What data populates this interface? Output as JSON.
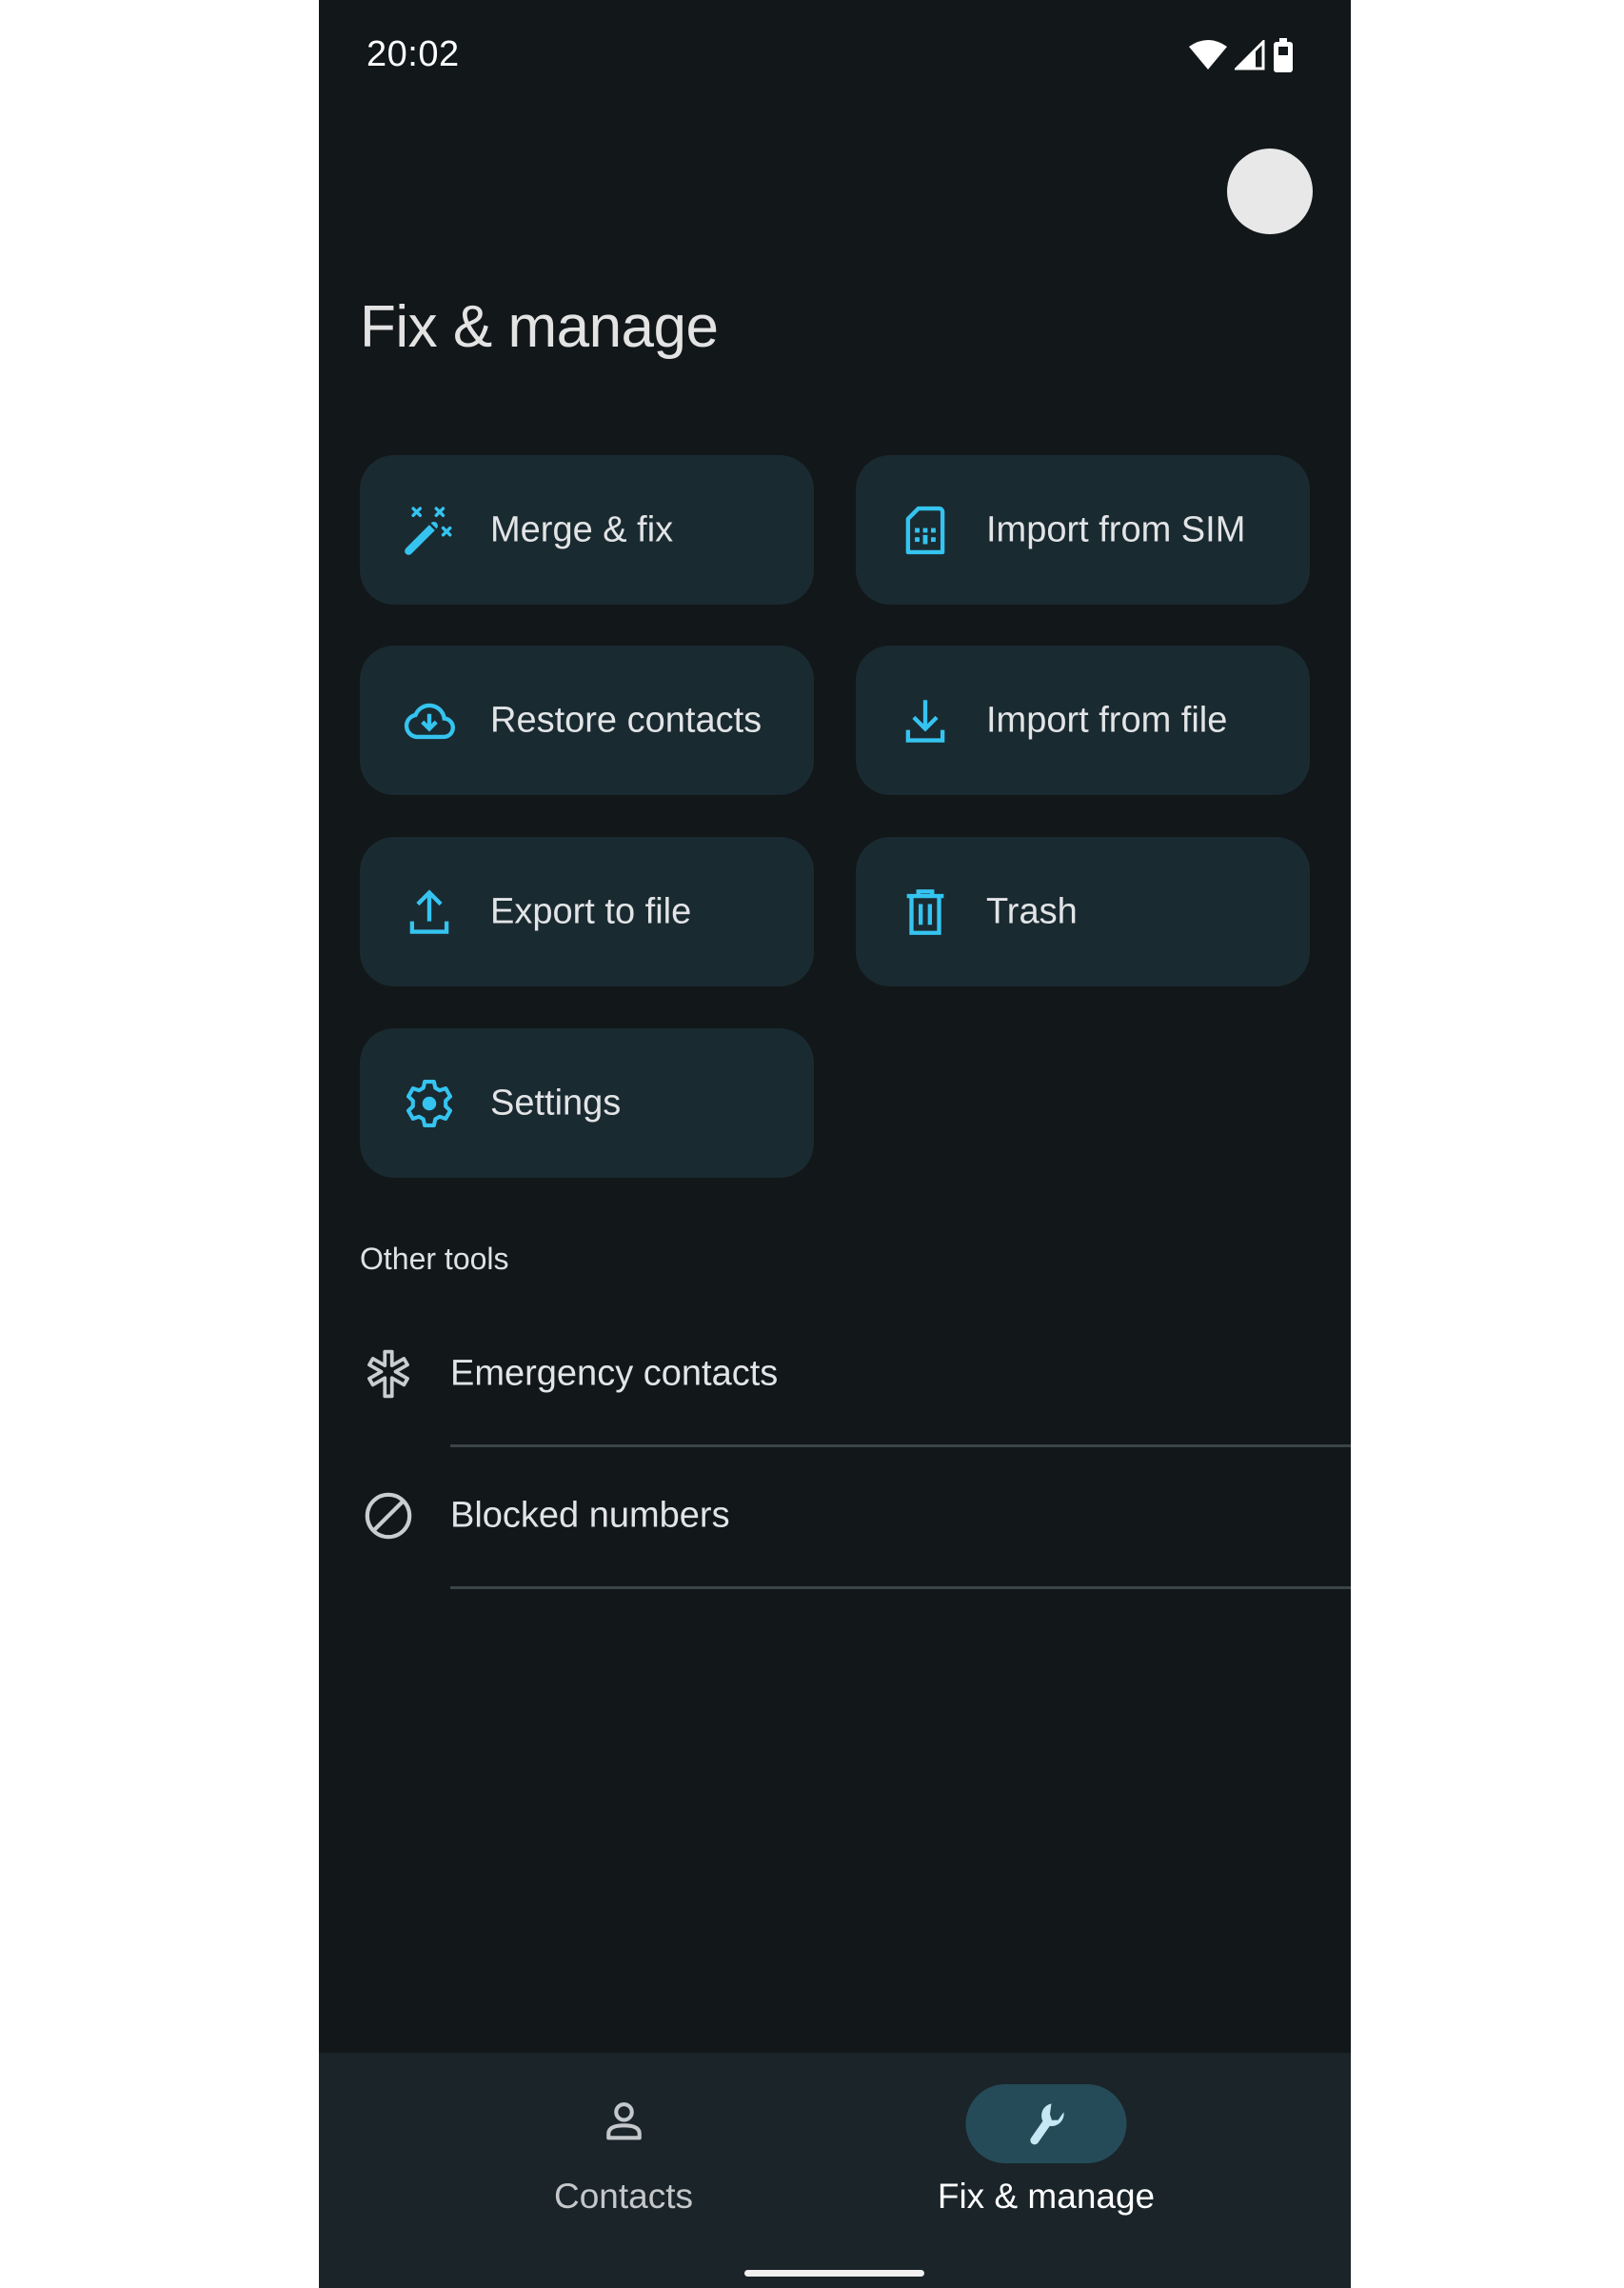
{
  "status_bar": {
    "time": "20:02",
    "icons": [
      "wifi-icon",
      "cellular-signal-icon",
      "battery-icon"
    ]
  },
  "header": {
    "avatar": "account-avatar",
    "title": "Fix & manage"
  },
  "actions": [
    {
      "label": "Merge & fix",
      "icon": "magic-wand-icon"
    },
    {
      "label": "Import from SIM",
      "icon": "sim-card-icon"
    },
    {
      "label": "Restore contacts",
      "icon": "cloud-download-icon"
    },
    {
      "label": "Import from file",
      "icon": "download-icon"
    },
    {
      "label": "Export to file",
      "icon": "upload-icon"
    },
    {
      "label": "Trash",
      "icon": "trash-icon"
    },
    {
      "label": "Settings",
      "icon": "gear-icon"
    }
  ],
  "other_tools": {
    "heading": "Other tools",
    "items": [
      {
        "label": "Emergency contacts",
        "icon": "medical-asterisk-icon"
      },
      {
        "label": "Blocked numbers",
        "icon": "block-icon"
      }
    ]
  },
  "bottom_nav": {
    "items": [
      {
        "label": "Contacts",
        "icon": "person-icon",
        "active": false
      },
      {
        "label": "Fix & manage",
        "icon": "wrench-icon",
        "active": true
      }
    ]
  },
  "colors": {
    "accent": "#35c4f0",
    "background": "#121719",
    "card": "#1a2a31",
    "nav_active_pill": "#254b58"
  }
}
